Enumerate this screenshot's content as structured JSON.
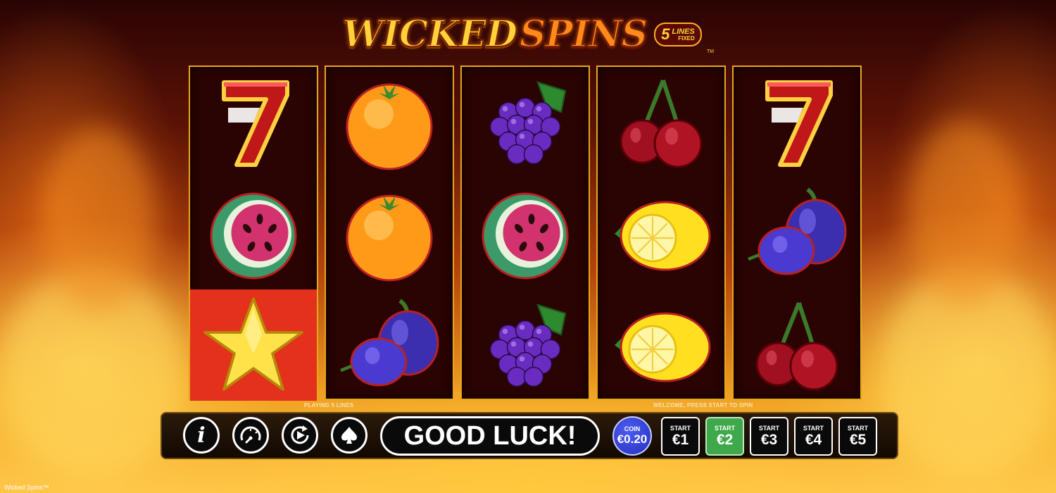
{
  "game": {
    "title_part1": "WICKED",
    "title_part2": "SPINS",
    "lines_number": "5",
    "lines_label": "LINES",
    "lines_fixed": "FIXED",
    "trademark": "TM",
    "footer_name": "Wicked Spins™"
  },
  "reels": [
    {
      "symbols": [
        "seven",
        "watermelon",
        "star"
      ],
      "highlighted_row": 2
    },
    {
      "symbols": [
        "orange",
        "orange",
        "plum"
      ]
    },
    {
      "symbols": [
        "grapes",
        "watermelon",
        "grapes"
      ]
    },
    {
      "symbols": [
        "cherries",
        "lemon",
        "lemon"
      ]
    },
    {
      "symbols": [
        "seven",
        "plum",
        "cherries"
      ]
    }
  ],
  "status": {
    "playing_lines": "PLAYING 5 LINES",
    "welcome": "WELCOME, PRESS START TO SPIN"
  },
  "controls": {
    "info_icon": "info-icon",
    "speed_icon": "speedometer-icon",
    "autoplay_icon": "autoplay-icon",
    "spade_icon": "spade-icon",
    "message": "GOOD LUCK!",
    "coin_label": "COIN",
    "coin_value": "€0.20",
    "start_label": "START",
    "stakes": [
      "€1",
      "€2",
      "€3",
      "€4",
      "€5"
    ],
    "selected_stake": "€2"
  },
  "colors": {
    "reel_border": "#e8a51e",
    "reel_bg": "#2a0303",
    "highlight": "#e3311b",
    "selected_stake": "#3ea84a",
    "coin": "#2f3ed8"
  }
}
